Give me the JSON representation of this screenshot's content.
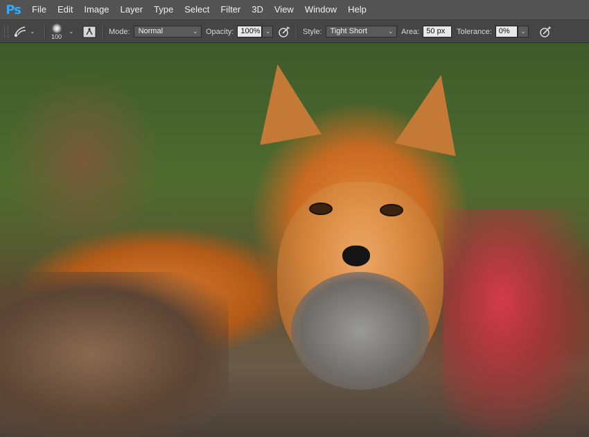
{
  "app": {
    "logo": "Ps"
  },
  "menu": [
    "File",
    "Edit",
    "Image",
    "Layer",
    "Type",
    "Select",
    "Filter",
    "3D",
    "View",
    "Window",
    "Help"
  ],
  "options": {
    "brush_size": "100",
    "mode_label": "Mode:",
    "mode_value": "Normal",
    "opacity_label": "Opacity:",
    "opacity_value": "100%",
    "style_label": "Style:",
    "style_value": "Tight Short",
    "area_label": "Area:",
    "area_value": "50 px",
    "tolerance_label": "Tolerance:",
    "tolerance_value": "0%"
  },
  "colors": {
    "menubar": "#535353",
    "optionsbar": "#454545",
    "ps_blue": "#31a8ff"
  },
  "icons": [
    "art-history-brush-icon",
    "brush-preset-icon",
    "brush-panel-toggle-icon",
    "airbrush-icon",
    "pressure-size-icon"
  ]
}
